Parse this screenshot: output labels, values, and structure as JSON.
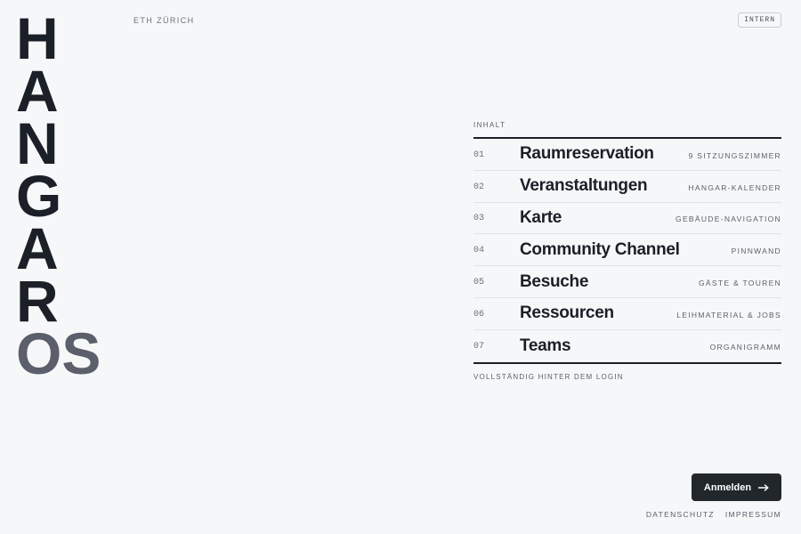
{
  "brand": {
    "letters": [
      "H",
      "A",
      "N",
      "G",
      "A",
      "R"
    ],
    "suffix": "OS"
  },
  "header": {
    "org": "ETH ZÜRICH",
    "badge": "INTERN"
  },
  "menu": {
    "heading": "INHALT",
    "items": [
      {
        "num": "01",
        "title": "Raumreservation",
        "sub": "9 SITZUNGSZIMMER"
      },
      {
        "num": "02",
        "title": "Veranstaltungen",
        "sub": "HANGAR-KALENDER"
      },
      {
        "num": "03",
        "title": "Karte",
        "sub": "GEBÄUDE-NAVIGATION"
      },
      {
        "num": "04",
        "title": "Community Channel",
        "sub": "PINNWAND"
      },
      {
        "num": "05",
        "title": "Besuche",
        "sub": "GÄSTE & TOUREN"
      },
      {
        "num": "06",
        "title": "Ressourcen",
        "sub": "LEIHMATERIAL & JOBS"
      },
      {
        "num": "07",
        "title": "Teams",
        "sub": "ORGANIGRAMM"
      }
    ],
    "footnote": "VOLLSTÄNDIG HINTER DEM LOGIN"
  },
  "login": {
    "label": "Anmelden",
    "icon": "arrow-right-icon"
  },
  "footer": {
    "privacy": "DATENSCHUTZ",
    "imprint": "IMPRESSUM"
  },
  "colors": {
    "background": "#f6f7f9",
    "text": "#1b1f27",
    "muted": "#5a5f6b",
    "button": "#22272b"
  }
}
